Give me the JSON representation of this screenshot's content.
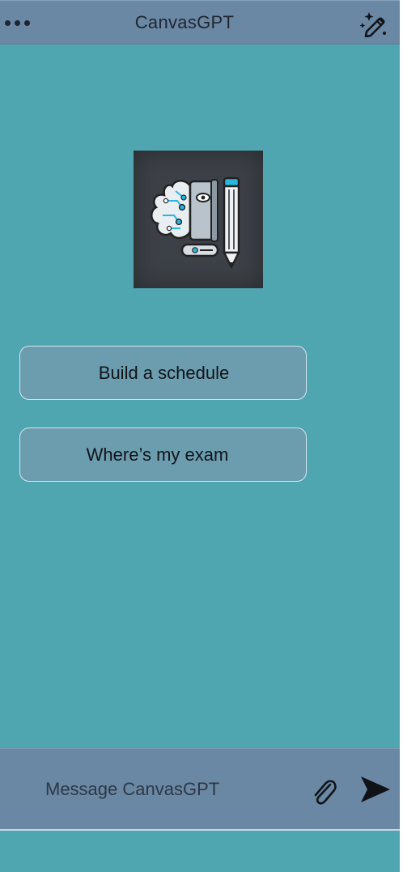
{
  "header": {
    "title": "CanvasGPT",
    "menu_icon": "more-dots-icon",
    "new_chat_icon": "magic-pencil-icon"
  },
  "logo": {
    "icon": "brain-book-pencil-logo"
  },
  "suggestions": [
    {
      "label": "Build a schedule"
    },
    {
      "label": "Where’s my exam"
    }
  ],
  "composer": {
    "placeholder": "Message CanvasGPT",
    "attach_icon": "paperclip-icon",
    "send_icon": "send-arrow-icon"
  },
  "colors": {
    "background": "#4fa6b0",
    "bar": "#6a87a3",
    "suggestion_fill": "#6c9daf",
    "logo_bg": "#3c4147",
    "accent": "#29b6e0"
  }
}
